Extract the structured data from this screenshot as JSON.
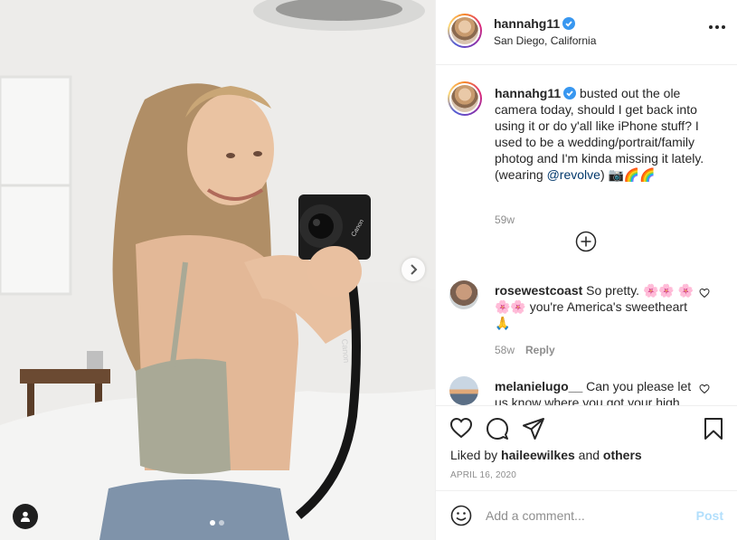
{
  "post": {
    "username": "hannahg11",
    "location": "San Diego, California"
  },
  "caption": {
    "username": "hannahg11",
    "text": "busted out the ole camera today, should I get back into using it or do y'all like iPhone stuff? I used to be a wedding/portrait/family photog and I'm kinda missing it lately. (wearing ",
    "mention": "@revolve",
    "trailing": ") 📷🌈🌈",
    "time": "59w"
  },
  "comments": [
    {
      "username": "rosewestcoast",
      "text": "So pretty. 🌸🌸 🌸🌸🌸 you're America's sweetheart🙏",
      "time": "58w",
      "reply_label": "Reply"
    },
    {
      "username": "melanielugo__",
      "text": "Can you please let us know where you got your high"
    }
  ],
  "likes": {
    "prefix": "Liked by",
    "user": "haileewilkes",
    "conjunction": "and",
    "others": "others"
  },
  "date": "APRIL 16, 2020",
  "composer": {
    "placeholder": "Add a comment...",
    "post_label": "Post"
  },
  "photo": {
    "camera_brand": "Canon",
    "strap_text": "Canon"
  },
  "colors": {
    "verified": "#3897f0",
    "post_disabled": "#b2dffc",
    "secondary_text": "#8e8e8e",
    "mention": "#00376b"
  }
}
